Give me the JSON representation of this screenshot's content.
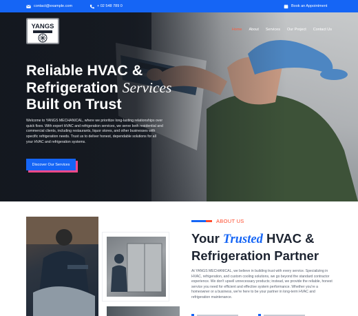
{
  "topbar": {
    "email": "contact@example.com",
    "phone": "+ 02 548 789 0",
    "appointment": "Book an Appointment"
  },
  "logo": {
    "text": "YANGS"
  },
  "nav": {
    "items": [
      "Home",
      "About",
      "Services",
      "Our Project",
      "Contact Us"
    ],
    "active": "Home"
  },
  "hero": {
    "title_line1": "Reliable HVAC &",
    "title_line2_plain": "Refrigeration ",
    "title_line2_script": "Services",
    "title_line3": "Built on Trust",
    "description": "Welcome to YANGS MECHANICAL, where we prioritize long-lasting relationships over quick fixes. With expert HVAC and refrigeration services, we serve both residential and commercial clients, including restaurants, liquor stores, and other businesses with specific refrigeration needs. Trust us to deliver honest, dependable solutions for all your HVAC and refrigeration systems.",
    "button": "Discover Our Services"
  },
  "about": {
    "tag": "ABOUT US",
    "title_plain1": "Your ",
    "title_script": "Trusted",
    "title_plain2": " HVAC &",
    "title_line2": "Refrigeration Partner",
    "description": "At YANGS MECHANICAL, we believe in building trust with every service. Specializing in HVAC, refrigeration, and custom cooling solutions, we go beyond the standard contractor experience. We don't upsell unnecessary products; instead, we provide the reliable, honest service you need for efficient and effective system performance. Whether you're a homeowner or a business, we're here to be your partner in long-term HVAC and refrigeration maintenance."
  },
  "colors": {
    "primary": "#1565f5",
    "accent": "#ff4a2b",
    "button_shadow": "#ff4a8a",
    "dark": "#1c2330"
  }
}
